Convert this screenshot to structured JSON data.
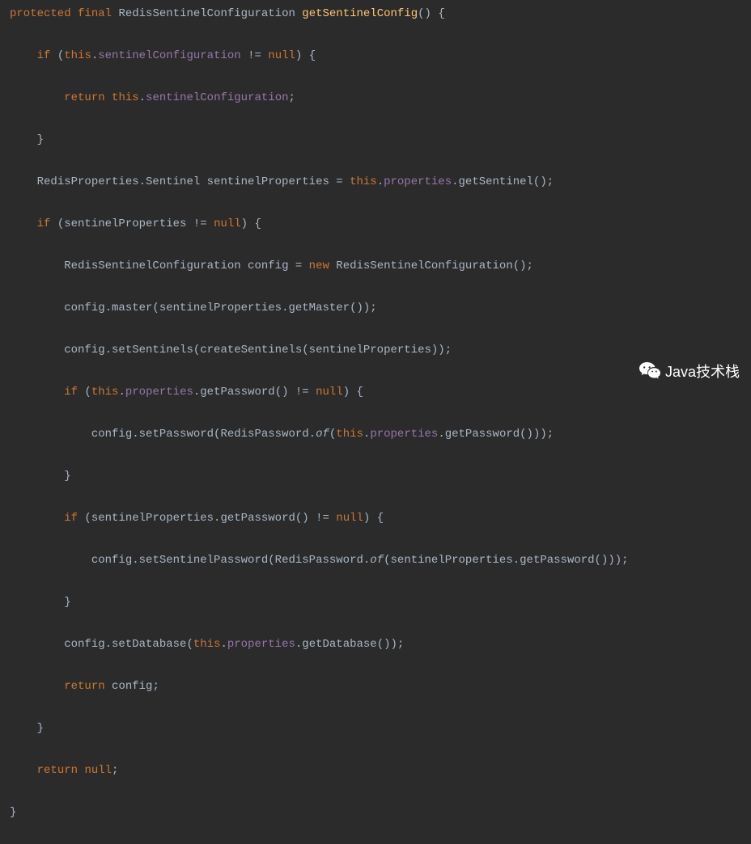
{
  "code": {
    "l1": {
      "kw1": "protected",
      "kw2": "final",
      "type": "RedisSentinelConfiguration",
      "mname": "getSentinelConfig",
      "parens": "()",
      "brace": " {"
    },
    "l2": {
      "kw": "if",
      "open": " (",
      "this": "this",
      "dot": ".",
      "prop": "sentinelConfiguration",
      "cmp": " != ",
      "null": "null",
      "close": ") {"
    },
    "l3": {
      "kw": "return",
      "sp": " ",
      "this": "this",
      "dot": ".",
      "prop": "sentinelConfiguration",
      "semi": ";"
    },
    "l4": {
      "brace": "}"
    },
    "l5": {
      "txt1": "RedisProperties.Sentinel sentinelProperties = ",
      "this": "this",
      "dot": ".",
      "prop": "properties",
      "txt2": ".getSentinel();"
    },
    "l6": {
      "kw": "if",
      "txt": " (sentinelProperties != ",
      "null": "null",
      "close": ") {"
    },
    "l7": {
      "txt1": "RedisSentinelConfiguration config = ",
      "new": "new",
      "txt2": " RedisSentinelConfiguration();"
    },
    "l8": {
      "txt": "config.master(sentinelProperties.getMaster());"
    },
    "l9": {
      "txt": "config.setSentinels(createSentinels(sentinelProperties));"
    },
    "l10": {
      "kw": "if",
      "open": " (",
      "this": "this",
      "dot": ".",
      "prop": "properties",
      "txt": ".getPassword() != ",
      "null": "null",
      "close": ") {"
    },
    "l11": {
      "txt1": "config.setPassword(RedisPassword.",
      "of": "of",
      "open": "(",
      "this": "this",
      "dot": ".",
      "prop": "properties",
      "txt2": ".getPassword()));"
    },
    "l12": {
      "brace": "}"
    },
    "l13": {
      "kw": "if",
      "txt": " (sentinelProperties.getPassword() != ",
      "null": "null",
      "close": ") {"
    },
    "l14": {
      "txt1": "config.setSentinelPassword(RedisPassword.",
      "of": "of",
      "txt2": "(sentinelProperties.getPassword()));"
    },
    "l15": {
      "brace": "}"
    },
    "l16": {
      "txt1": "config.setDatabase(",
      "this": "this",
      "dot": ".",
      "prop": "properties",
      "txt2": ".getDatabase());"
    },
    "l17": {
      "kw": "return",
      "txt": " config;"
    },
    "l18": {
      "brace": "}"
    },
    "l19": {
      "kw": "return",
      "sp": " ",
      "null": "null",
      "semi": ";"
    },
    "l20": {
      "brace": "}"
    }
  },
  "watermark": {
    "text": "Java技术栈"
  }
}
